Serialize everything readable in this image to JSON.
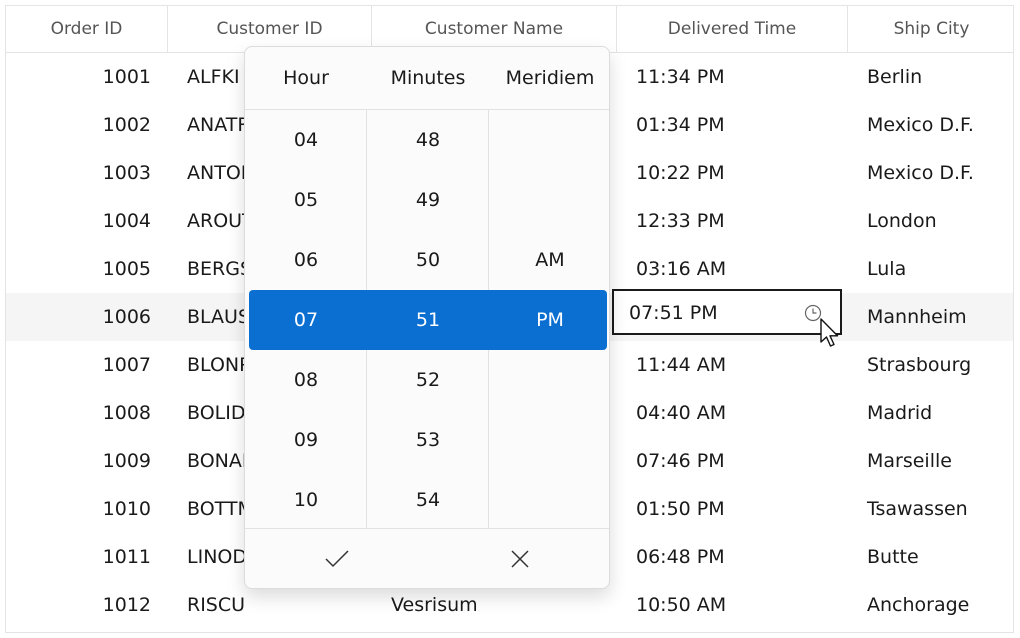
{
  "grid": {
    "columns": [
      "Order ID",
      "Customer ID",
      "Customer Name",
      "Delivered Time",
      "Ship City"
    ],
    "rows": [
      {
        "order_id": "1001",
        "customer_id": "ALFKI",
        "customer_name": "",
        "delivered_time": "11:34 PM",
        "ship_city": "Berlin"
      },
      {
        "order_id": "1002",
        "customer_id": "ANATR",
        "customer_name": "",
        "delivered_time": "01:34 PM",
        "ship_city": "Mexico D.F."
      },
      {
        "order_id": "1003",
        "customer_id": "ANTON",
        "customer_name": "",
        "delivered_time": "10:22 PM",
        "ship_city": "Mexico D.F."
      },
      {
        "order_id": "1004",
        "customer_id": "AROUT",
        "customer_name": "",
        "delivered_time": "12:33 PM",
        "ship_city": "London"
      },
      {
        "order_id": "1005",
        "customer_id": "BERGS",
        "customer_name": "",
        "delivered_time": "03:16 AM",
        "ship_city": "Lula"
      },
      {
        "order_id": "1006",
        "customer_id": "BLAUS",
        "customer_name": "",
        "delivered_time": "07:51 PM",
        "ship_city": "Mannheim"
      },
      {
        "order_id": "1007",
        "customer_id": "BLONP",
        "customer_name": "",
        "delivered_time": "11:44 AM",
        "ship_city": "Strasbourg"
      },
      {
        "order_id": "1008",
        "customer_id": "BOLID",
        "customer_name": "",
        "delivered_time": "04:40 AM",
        "ship_city": "Madrid"
      },
      {
        "order_id": "1009",
        "customer_id": "BONAP",
        "customer_name": "",
        "delivered_time": "07:46 PM",
        "ship_city": "Marseille"
      },
      {
        "order_id": "1010",
        "customer_id": "BOTTM",
        "customer_name": "",
        "delivered_time": "01:50 PM",
        "ship_city": "Tsawassen"
      },
      {
        "order_id": "1011",
        "customer_id": "LINOD",
        "customer_name": "",
        "delivered_time": "06:48 PM",
        "ship_city": "Butte"
      },
      {
        "order_id": "1012",
        "customer_id": "RISCU",
        "customer_name": "Vesrisum",
        "delivered_time": "10:50 AM",
        "ship_city": "Anchorage"
      }
    ],
    "editing_value": "07:51 PM"
  },
  "time_picker": {
    "headers": [
      "Hour",
      "Minutes",
      "Meridiem"
    ],
    "hours": [
      "04",
      "05",
      "06",
      "07",
      "08",
      "09",
      "10"
    ],
    "minutes": [
      "48",
      "49",
      "50",
      "51",
      "52",
      "53",
      "54"
    ],
    "meridiem": [
      "",
      "",
      "AM",
      "PM",
      "",
      "",
      ""
    ],
    "selected_index": 3,
    "accept_icon": "checkmark-icon",
    "dismiss_icon": "close-icon"
  },
  "colors": {
    "accent": "#0a6fd1",
    "selected_row": "#f5f5f5",
    "border": "#e4e4e4"
  }
}
